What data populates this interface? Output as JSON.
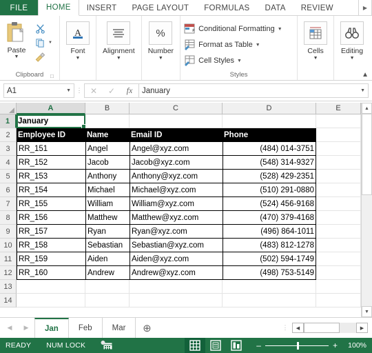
{
  "ribbon": {
    "file_tab": "FILE",
    "tabs": [
      {
        "label": "HOME",
        "active": true
      },
      {
        "label": "INSERT",
        "active": false
      },
      {
        "label": "PAGE LAYOUT",
        "active": false
      },
      {
        "label": "FORMULAS",
        "active": false
      },
      {
        "label": "DATA",
        "active": false
      },
      {
        "label": "REVIEW",
        "active": false
      }
    ],
    "overflow_icon": "chevron-right-icon",
    "collapse_icon": "chevron-up-icon",
    "groups": {
      "clipboard": {
        "label": "Clipboard",
        "paste": "Paste",
        "cut_icon": "scissors-icon",
        "copy_icon": "copy-icon",
        "format_painter_icon": "paintbrush-icon",
        "launcher_icon": "dialog-launcher-icon"
      },
      "font": {
        "label": "Font"
      },
      "alignment": {
        "label": "Alignment"
      },
      "number": {
        "label": "Number"
      },
      "styles": {
        "label": "Styles",
        "items": [
          {
            "label": "Conditional Formatting",
            "icon": "conditional-formatting-icon"
          },
          {
            "label": "Format as Table",
            "icon": "format-as-table-icon"
          },
          {
            "label": "Cell Styles",
            "icon": "cell-styles-icon"
          }
        ]
      },
      "cells": {
        "label": "Cells"
      },
      "editing": {
        "label": "Editing"
      }
    }
  },
  "formula_bar": {
    "name_box": "A1",
    "cancel_icon": "cancel-icon",
    "enter_icon": "check-icon",
    "fx_icon": "fx-icon",
    "value": "January",
    "expand_icon": "chevron-down-icon"
  },
  "grid": {
    "columns": [
      {
        "label": "A",
        "width": 100,
        "selected": true
      },
      {
        "label": "B",
        "width": 64,
        "selected": false
      },
      {
        "label": "C",
        "width": 135,
        "selected": false
      },
      {
        "label": "D",
        "width": 136,
        "selected": false
      },
      {
        "label": "E",
        "width": 65,
        "selected": false
      }
    ],
    "rows": [
      {
        "num": "1",
        "selected": true
      },
      {
        "num": "2",
        "selected": false
      },
      {
        "num": "3",
        "selected": false
      },
      {
        "num": "4",
        "selected": false
      },
      {
        "num": "5",
        "selected": false
      },
      {
        "num": "6",
        "selected": false
      },
      {
        "num": "7",
        "selected": false
      },
      {
        "num": "8",
        "selected": false
      },
      {
        "num": "9",
        "selected": false
      },
      {
        "num": "10",
        "selected": false
      },
      {
        "num": "11",
        "selected": false
      },
      {
        "num": "12",
        "selected": false
      },
      {
        "num": "13",
        "selected": false
      },
      {
        "num": "14",
        "selected": false
      }
    ],
    "title_cell": "January",
    "table_headers": [
      "Employee ID",
      "Name",
      "Email ID",
      "Phone"
    ],
    "table_rows": [
      [
        "RR_151",
        "Angel",
        "Angel@xyz.com",
        "(484) 014-3751"
      ],
      [
        "RR_152",
        "Jacob",
        "Jacob@xyz.com",
        "(548) 314-9327"
      ],
      [
        "RR_153",
        "Anthony",
        "Anthony@xyz.com",
        "(528) 429-2351"
      ],
      [
        "RR_154",
        "Michael",
        "Michael@xyz.com",
        "(510) 291-0880"
      ],
      [
        "RR_155",
        "William",
        "William@xyz.com",
        "(524) 456-9168"
      ],
      [
        "RR_156",
        "Matthew",
        "Matthew@xyz.com",
        "(470) 379-4168"
      ],
      [
        "RR_157",
        "Ryan",
        "Ryan@xyz.com",
        "(496) 864-1011"
      ],
      [
        "RR_158",
        "Sebastian",
        "Sebastian@xyz.com",
        "(483) 812-1278"
      ],
      [
        "RR_159",
        "Aiden",
        "Aiden@xyz.com",
        "(502) 594-1749"
      ],
      [
        "RR_160",
        "Andrew",
        "Andrew@xyz.com",
        "(498) 753-5149"
      ]
    ],
    "accent_color": "#217346"
  },
  "sheet_tabs": {
    "prev_icon": "triangle-left-icon",
    "next_icon": "triangle-right-icon",
    "tabs": [
      {
        "label": "Jan",
        "active": true
      },
      {
        "label": "Feb",
        "active": false
      },
      {
        "label": "Mar",
        "active": false
      }
    ],
    "add_icon": "plus-circle-icon",
    "grip_icon": "grip-dots-icon",
    "hscroll_left_icon": "triangle-left-icon",
    "hscroll_right_icon": "triangle-right-icon"
  },
  "status_bar": {
    "mode": "READY",
    "num_lock": "NUM LOCK",
    "macro_icon": "record-macro-icon",
    "views": [
      {
        "name": "normal-view",
        "icon": "grid-icon",
        "active": true
      },
      {
        "name": "page-layout-view",
        "icon": "page-layout-icon",
        "active": false
      },
      {
        "name": "page-break-view",
        "icon": "page-break-icon",
        "active": false
      }
    ],
    "zoom_out": "–",
    "zoom_in": "+",
    "zoom_level": "100%"
  }
}
